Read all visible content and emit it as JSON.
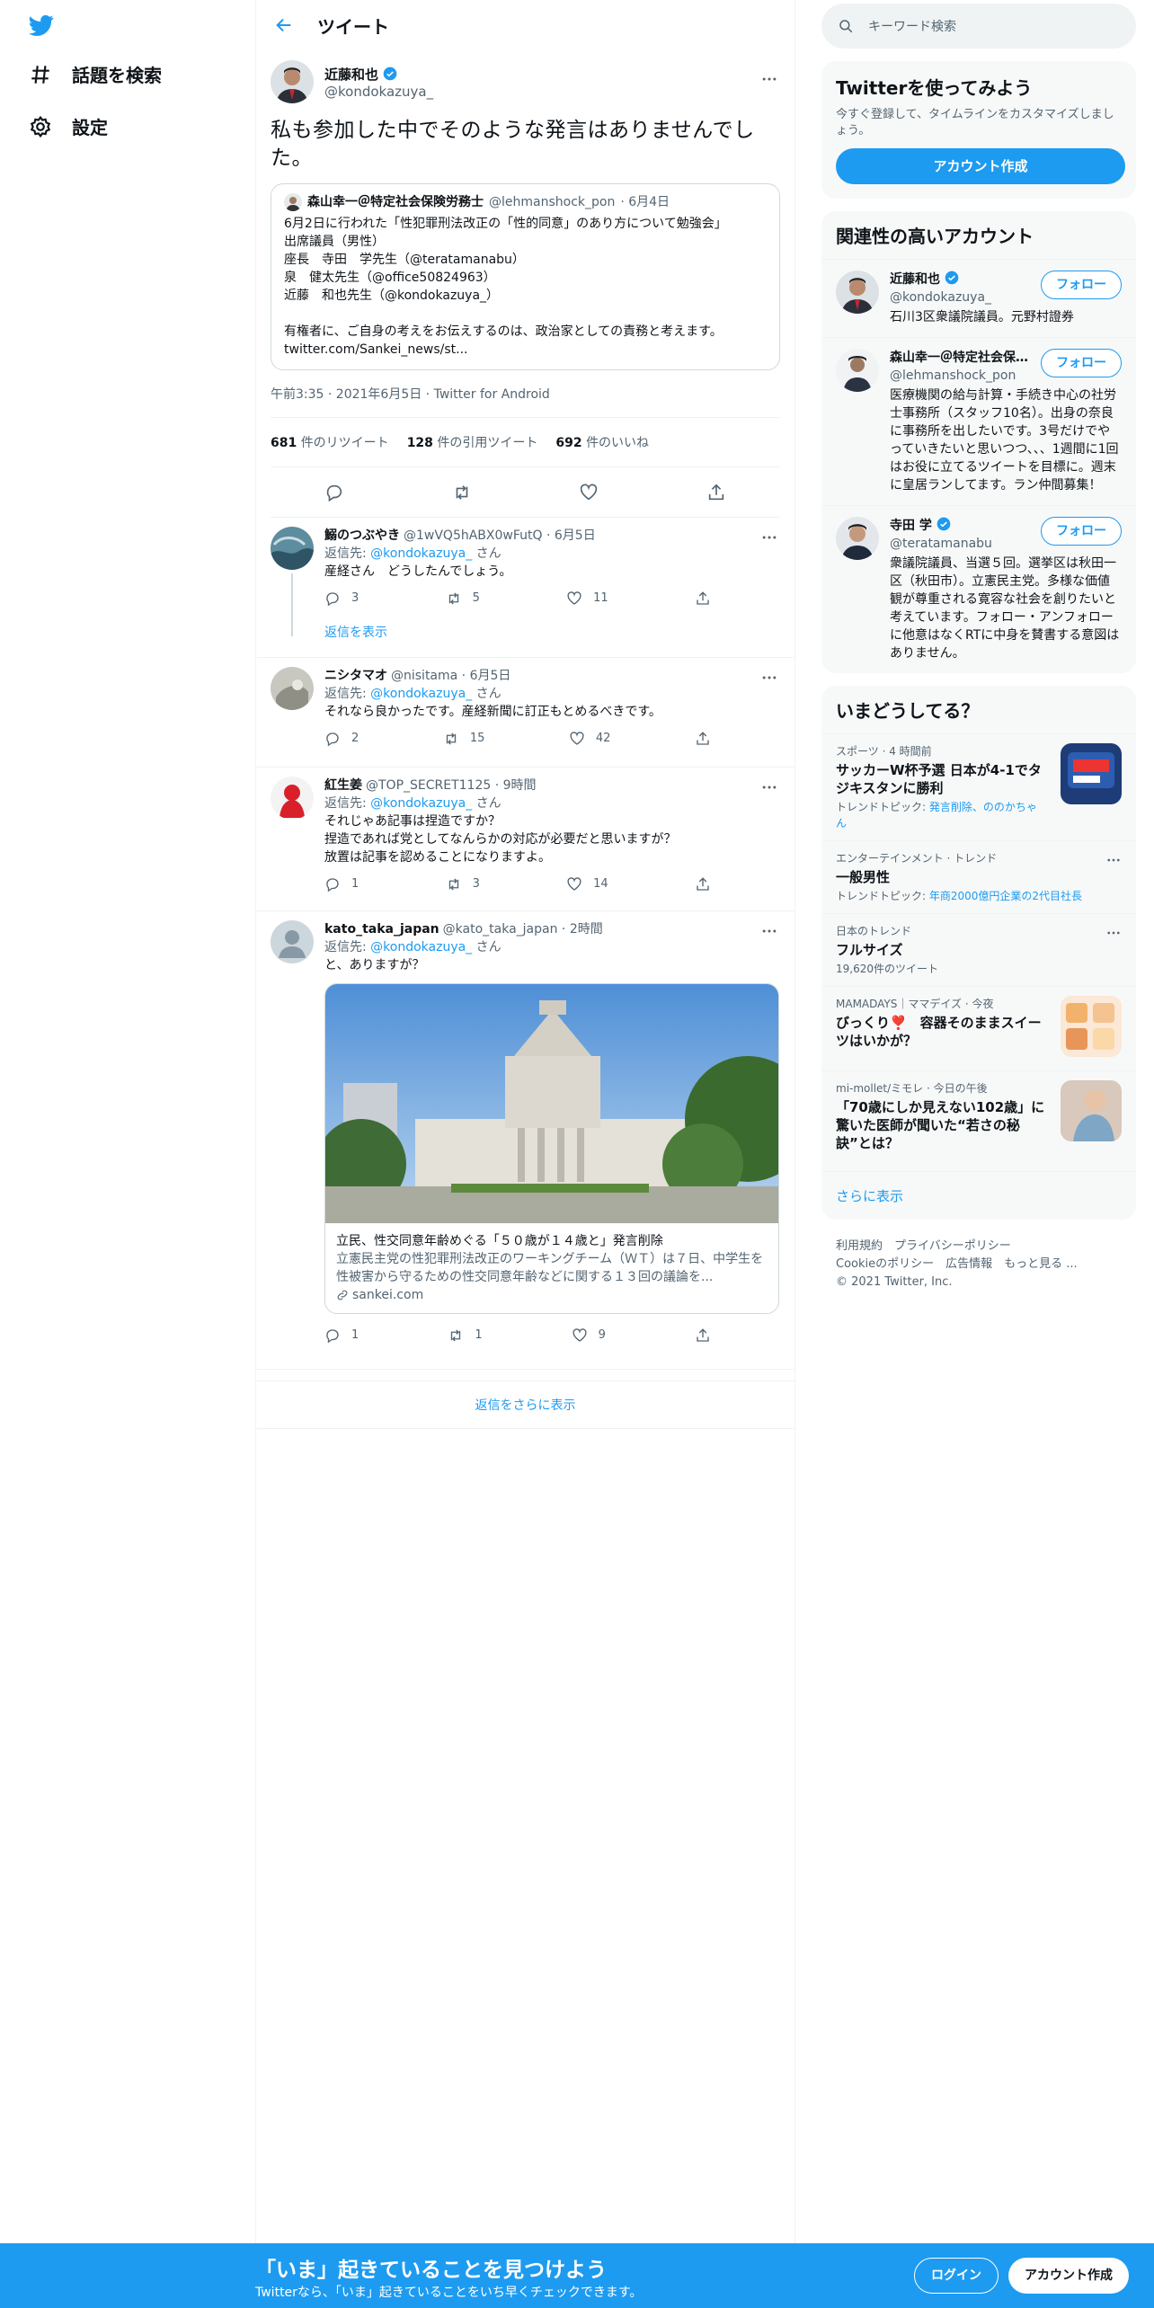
{
  "nav": {
    "explore": "話題を検索",
    "settings": "設定"
  },
  "header": {
    "title": "ツイート"
  },
  "tweet": {
    "name": "近藤和也",
    "handle": "@kondokazuya_",
    "text": "私も参加した中でそのような発言はありませんでした。",
    "quote": {
      "name": "森山幸一＠特定社会保険労務士",
      "handle": "@lehmanshock_pon",
      "date": "· 6月4日",
      "lines": [
        "6月2日に行われた「性犯罪刑法改正の「性的同意」のあり方について勉強会」",
        "出席議員（男性）",
        "座長　寺田　学先生（@teratamanabu）",
        "泉　健太先生（@office50824963）",
        "近藤　和也先生（@kondokazuya_）",
        "",
        "有権者に、ご自身の考えをお伝えするのは、政治家としての責務と考えます。",
        "twitter.com/Sankei_news/st..."
      ]
    },
    "time": "午前3:35 · 2021年6月5日 · Twitter for Android",
    "retweets": "681",
    "retweets_label": "件のリツイート",
    "quotes": "128",
    "quotes_label": "件の引用ツイート",
    "likes": "692",
    "likes_label": "件のいいね"
  },
  "replies": [
    {
      "name": "鰯のつぶやき",
      "handle": "@1wVQ5hABX0wFutQ · 6月5日",
      "to_prefix": "返信先: ",
      "to": "@kondokazuya_",
      "to_suffix": "さん",
      "text": "産経さん　どうしたんでしょう。",
      "reply": "3",
      "retweet": "5",
      "like": "11",
      "show_replies": "返信を表示"
    },
    {
      "name": "ニシタマオ",
      "handle": "@nisitama · 6月5日",
      "to_prefix": "返信先: ",
      "to": "@kondokazuya_",
      "to_suffix": "さん",
      "text": "それなら良かったです。産経新聞に訂正もとめるべきです。",
      "reply": "2",
      "retweet": "15",
      "like": "42"
    },
    {
      "name": "紅生姜",
      "handle": "@TOP_SECRET1125 · 9時間",
      "to_prefix": "返信先: ",
      "to": "@kondokazuya_",
      "to_suffix": "さん",
      "text1": "それじゃあ記事は捏造ですか？",
      "text2": "捏造であれば党としてなんらかの対応が必要だと思いますが？",
      "text3": "放置は記事を認めることになりますよ。",
      "reply": "1",
      "retweet": "3",
      "like": "14"
    },
    {
      "name": "kato_taka_japan",
      "handle": "@kato_taka_japan · 2時間",
      "to_prefix": "返信先: ",
      "to": "@kondokazuya_",
      "to_suffix": "さん",
      "text": "と、ありますが？",
      "card_title": "立民、性交同意年齢めぐる「５０歳が１４歳と」発言削除",
      "card_desc": "立憲民主党の性犯罪刑法改正のワーキングチーム（ＷＴ）は７日、中学生を性被害から守るための性交同意年齢などに関する１３回の議論を...",
      "card_domain": "sankei.com",
      "reply": "1",
      "retweet": "1",
      "like": "9"
    }
  ],
  "more_replies": "返信をさらに表示",
  "sidebar": {
    "search_placeholder": "キーワード検索",
    "signup_title": "Twitterを使ってみよう",
    "signup_desc": "今すぐ登録して、タイムラインをカスタマイズしましょう。",
    "signup_button": "アカウント作成",
    "related_title": "関連性の高いアカウント",
    "follow_label": "フォロー",
    "accounts": [
      {
        "name": "近藤和也",
        "handle": "@kondokazuya_",
        "bio": "石川3区衆議院議員。元野村證券"
      },
      {
        "name": "森山幸一＠特定社会保険労務士",
        "handle": "@lehmanshock_pon",
        "bio": "医療機関の給与計算・手続き中心の社労士事務所（スタッフ10名）。出身の奈良に事務所を出したいです。3号だけでやっていきたいと思いつつ、、、1週間に1回はお役に立てるツイートを目標に。週末に皇居ランしてます。ラン仲間募集！"
      },
      {
        "name": "寺田 学",
        "handle": "@teratamanabu",
        "bio": "衆議院議員、当選５回。選挙区は秋田一区（秋田市）。立憲民主党。多様な価値観が尊重される寛容な社会を創りたいと考えています。フォロー・アンフォローに他意はなくRTに中身を賛書する意図はありません。"
      }
    ],
    "trends_title": "いまどうしてる？",
    "trends": [
      {
        "cat": "スポーツ · 4 時間前",
        "title": "サッカーW杯予選 日本が4-1でタジキスタンに勝利",
        "sub_prefix": "トレンドトピック: ",
        "sub": "発言削除、ののかちゃん"
      },
      {
        "cat": "エンターテインメント · トレンド",
        "title": "一般男性",
        "sub_prefix": "トレンドトピック: ",
        "sub": "年商2000億円企業の2代目社長"
      },
      {
        "cat": "日本のトレンド",
        "title": "フルサイズ",
        "sub": "19,620件のツイート"
      },
      {
        "cat": "MAMADAYS｜ママデイズ · 今夜",
        "title": "びっくり❣️　容器そのままスイーツはいかが？"
      },
      {
        "cat": "mi-mollet/ミモレ · 今日の午後",
        "title": "「70歳にしか見えない102歳」に驚いた医師が聞いた“若さの秘訣”とは？"
      }
    ],
    "show_more": "さらに表示",
    "footer1": "利用規約　プライバシーポリシー",
    "footer2": "Cookieのポリシー　広告情報　もっと見る ...",
    "footer3": "© 2021 Twitter, Inc."
  },
  "bottom": {
    "title": "「いま」起きていることを見つけよう",
    "subtitle": "Twitterなら、「いま」起きていることをいち早くチェックできます。",
    "login": "ログイン",
    "signup": "アカウント作成"
  },
  "colors": {
    "accent": "#1d9bf0",
    "text": "#0f1419",
    "muted": "#536471"
  }
}
